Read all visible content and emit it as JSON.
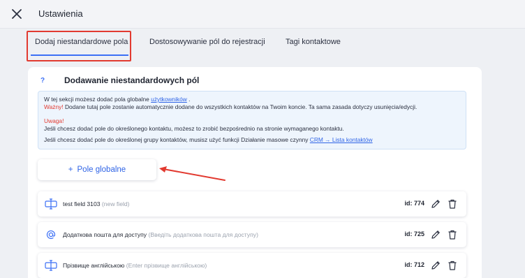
{
  "header": {
    "title": "Ustawienia",
    "close_icon": "close-icon"
  },
  "tabs": [
    {
      "label": "Dodaj niestandardowe pola",
      "active": true
    },
    {
      "label": "Dostosowywanie pól do rejestracji",
      "active": false
    },
    {
      "label": "Tagi kontaktowe",
      "active": false
    }
  ],
  "section": {
    "help_icon": "?",
    "title": "Dodawanie niestandardowych pól"
  },
  "info": {
    "line1_prefix": "W tej sekcji możesz dodać pola globalne",
    "line1_link": "użytkowników",
    "line1_suffix": ".",
    "line2_warn": "Ważny!",
    "line2_text": "Dodane tutaj pole zostanie automatycznie dodane do wszystkich kontaktów na Twoim koncie. Ta sama zasada dotyczy usunięcia/edycji.",
    "line3_warn": "Uwaga!",
    "line4_text": "Jeśli chcesz dodać pole do określonego kontaktu, możesz to zrobić bezpośrednio na stronie wymaganego kontaktu.",
    "line5_text": "Jeśli chcesz dodać pole do określonej grupy kontaktów, musisz użyć funkcji Działanie masowe czynny",
    "line5_link": "CRM → Lista kontaktów"
  },
  "add_button": {
    "plus": "+",
    "label": "Pole globalne"
  },
  "fields": [
    {
      "icon": "text-field-icon",
      "name": "test field 3103",
      "hint": "(new field)",
      "id": "id: 774"
    },
    {
      "icon": "at-sign-icon",
      "name": "Додаткова пошта для доступу",
      "hint": "(Введіть додаткова пошта для доступу)",
      "id": "id: 725"
    },
    {
      "icon": "text-field-icon",
      "name": "Прізвище англійською",
      "hint": "(Enter прізвище англійською)",
      "id": "id: 712"
    }
  ],
  "colors": {
    "accent": "#3b6ff5",
    "highlight": "#e23a30",
    "info_bg": "#eef5fd",
    "link": "#2f64e6"
  }
}
